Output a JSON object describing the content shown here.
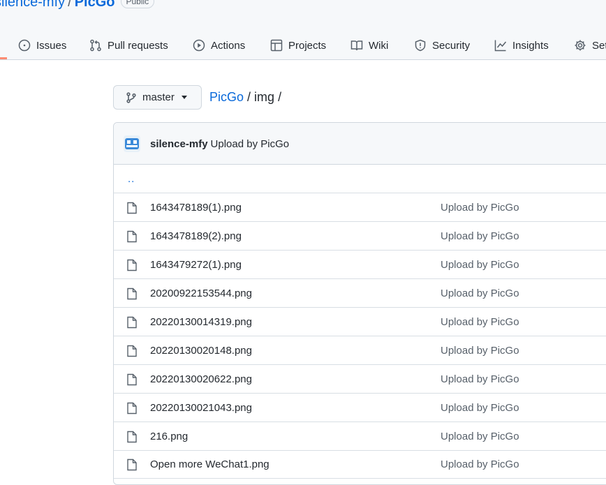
{
  "repo": {
    "owner": "silence-mfy",
    "separator": "/",
    "name": "PicGo",
    "visibility": "Public"
  },
  "tabs": [
    {
      "label": "Issues",
      "icon": "issue-opened-icon"
    },
    {
      "label": "Pull requests",
      "icon": "git-pull-request-icon"
    },
    {
      "label": "Actions",
      "icon": "play-icon"
    },
    {
      "label": "Projects",
      "icon": "table-icon"
    },
    {
      "label": "Wiki",
      "icon": "book-icon"
    },
    {
      "label": "Security",
      "icon": "shield-icon"
    },
    {
      "label": "Insights",
      "icon": "graph-icon"
    },
    {
      "label": "Settings",
      "icon": "gear-icon"
    }
  ],
  "branch": {
    "name": "master",
    "icon": "git-branch-icon"
  },
  "breadcrumb": {
    "repo": "PicGo",
    "sep1": "/",
    "folder": "img",
    "sep2": "/"
  },
  "commit": {
    "author": "silence-mfy",
    "message": "Upload by PicGo"
  },
  "parent_dir": "..",
  "files": [
    {
      "name": "1643478189(1).png",
      "message": "Upload by PicGo"
    },
    {
      "name": "1643478189(2).png",
      "message": "Upload by PicGo"
    },
    {
      "name": "1643479272(1).png",
      "message": "Upload by PicGo"
    },
    {
      "name": "20200922153544.png",
      "message": "Upload by PicGo"
    },
    {
      "name": "20220130014319.png",
      "message": "Upload by PicGo"
    },
    {
      "name": "20220130020148.png",
      "message": "Upload by PicGo"
    },
    {
      "name": "20220130020622.png",
      "message": "Upload by PicGo"
    },
    {
      "name": "20220130021043.png",
      "message": "Upload by PicGo"
    },
    {
      "name": "216.png",
      "message": "Upload by PicGo"
    },
    {
      "name": "Open more WeChat1.png",
      "message": "Upload by PicGo"
    }
  ],
  "colors": {
    "link": "#0969da",
    "text": "#24292f",
    "muted": "#57606a",
    "border": "#d0d7de",
    "header_bg": "#f6f8fa",
    "active_tab": "#fd8c73"
  }
}
